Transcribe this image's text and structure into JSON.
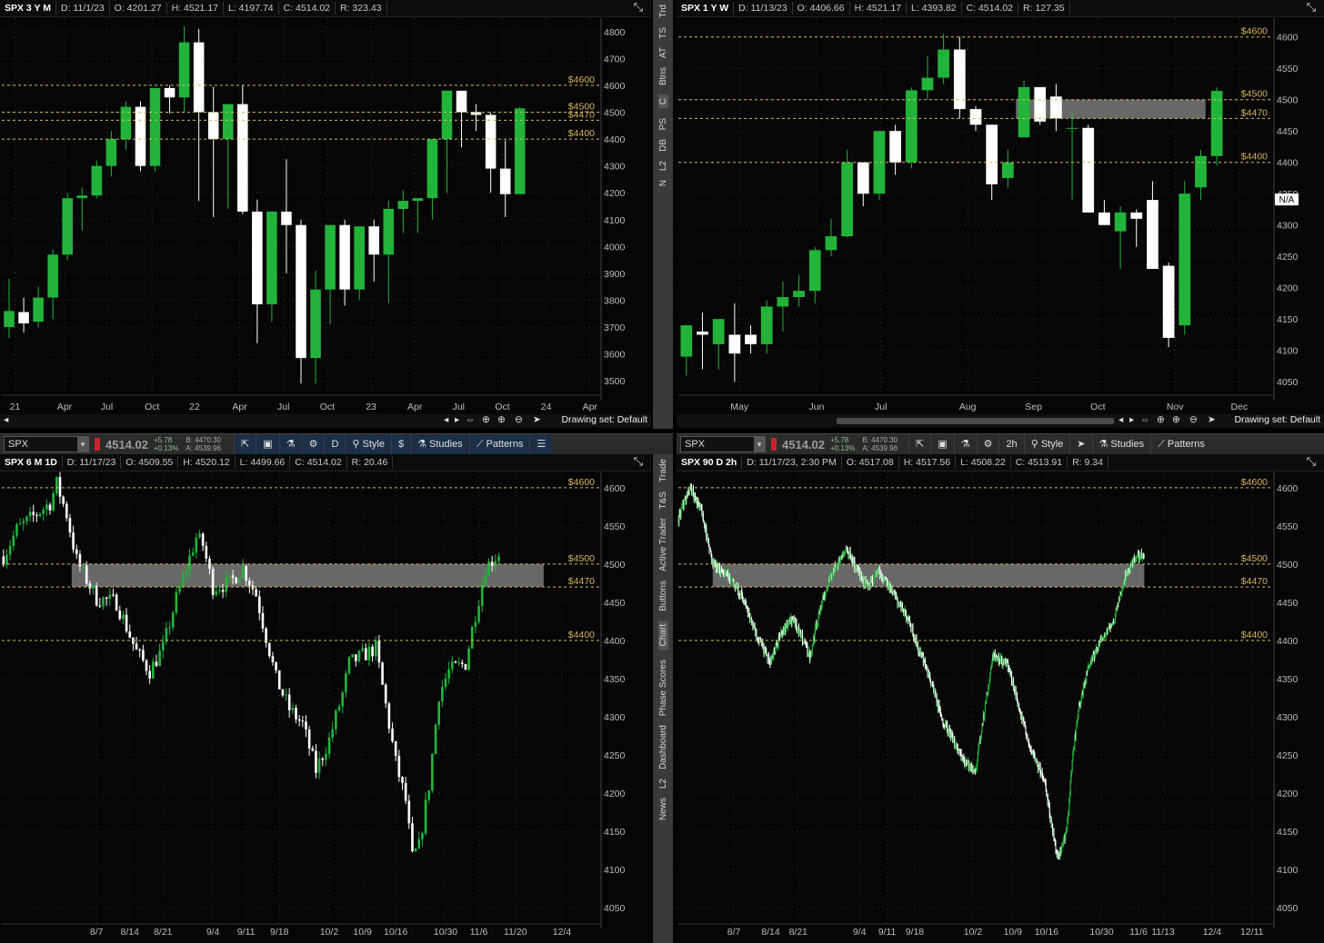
{
  "panels": [
    {
      "id": "tl",
      "header": [
        "SPX 3 Y M",
        "D: 11/1/23",
        "O: 4201.27",
        "H: 4521.17",
        "L: 4197.74",
        "C: 4514.02",
        "R: 323.43"
      ],
      "ylim": [
        3450,
        4850
      ],
      "yticks": [
        3500,
        3600,
        3700,
        3800,
        3900,
        4000,
        4100,
        4200,
        4300,
        4400,
        4500,
        4600,
        4700,
        4800
      ],
      "levels": [
        {
          "price": 4600,
          "label": "$4600"
        },
        {
          "price": 4500,
          "label": "$4500"
        },
        {
          "price": 4470,
          "label": "$4470"
        },
        {
          "price": 4400,
          "label": "$4400"
        }
      ],
      "zone": null,
      "xticks": [
        {
          "i": 0.4,
          "label": "21"
        },
        {
          "i": 3.8,
          "label": "Apr"
        },
        {
          "i": 6.7,
          "label": "Jul"
        },
        {
          "i": 9.8,
          "label": "Oct"
        },
        {
          "i": 12.7,
          "label": "22"
        },
        {
          "i": 15.8,
          "label": "Apr"
        },
        {
          "i": 18.8,
          "label": "Jul"
        },
        {
          "i": 21.8,
          "label": "Oct"
        },
        {
          "i": 24.8,
          "label": "23"
        },
        {
          "i": 27.8,
          "label": "Apr"
        },
        {
          "i": 30.8,
          "label": "Jul"
        },
        {
          "i": 33.8,
          "label": "Oct"
        },
        {
          "i": 36.8,
          "label": "24"
        },
        {
          "i": 39.8,
          "label": "Apr"
        }
      ],
      "slots": 41,
      "candles": [
        [
          3700,
          3880,
          3660,
          3760
        ],
        [
          3756,
          3810,
          3680,
          3714
        ],
        [
          3720,
          3850,
          3700,
          3810
        ],
        [
          3810,
          3990,
          3730,
          3970
        ],
        [
          3970,
          4200,
          3950,
          4180
        ],
        [
          4180,
          4220,
          4060,
          4190
        ],
        [
          4190,
          4320,
          4180,
          4300
        ],
        [
          4300,
          4430,
          4260,
          4400
        ],
        [
          4400,
          4540,
          4360,
          4520
        ],
        [
          4520,
          4540,
          4280,
          4300
        ],
        [
          4300,
          4560,
          4280,
          4590
        ],
        [
          4590,
          4600,
          4495,
          4555
        ],
        [
          4555,
          4820,
          4500,
          4760
        ],
        [
          4760,
          4810,
          4170,
          4500
        ],
        [
          4500,
          4595,
          4110,
          4400
        ],
        [
          4400,
          4510,
          4140,
          4530
        ],
        [
          4530,
          4600,
          4120,
          4130
        ],
        [
          4130,
          4175,
          3640,
          3785
        ],
        [
          3785,
          4130,
          3720,
          4130
        ],
        [
          4130,
          4325,
          3900,
          4080
        ],
        [
          4080,
          4100,
          3490,
          3585
        ],
        [
          3585,
          3910,
          3490,
          3840
        ],
        [
          3840,
          4080,
          3710,
          4080
        ],
        [
          4080,
          4100,
          3780,
          3840
        ],
        [
          3840,
          4040,
          3800,
          4075
        ],
        [
          4075,
          4100,
          3870,
          3970
        ],
        [
          3970,
          4170,
          3790,
          4140
        ],
        [
          4140,
          4210,
          4050,
          4170
        ],
        [
          4170,
          4180,
          4050,
          4180
        ],
        [
          4180,
          4400,
          4100,
          4400
        ],
        [
          4400,
          4540,
          4200,
          4580
        ],
        [
          4580,
          4570,
          4370,
          4500
        ],
        [
          4500,
          4530,
          4430,
          4490
        ],
        [
          4490,
          4500,
          4200,
          4290
        ],
        [
          4290,
          4395,
          4110,
          4195
        ],
        [
          4195,
          4520,
          4195,
          4514
        ]
      ]
    },
    {
      "id": "tr",
      "header": [
        "SPX 1 Y W",
        "D: 11/13/23",
        "O: 4406.66",
        "H: 4521.17",
        "L: 4393.82",
        "C: 4514.02",
        "R: 127.35"
      ],
      "ylim": [
        4030,
        4630
      ],
      "yticks": [
        4050,
        4100,
        4150,
        4200,
        4250,
        4300,
        4350,
        4400,
        4450,
        4500,
        4550,
        4600
      ],
      "levels": [
        {
          "price": 4600,
          "label": "$4600"
        },
        {
          "price": 4500,
          "label": "$4500"
        },
        {
          "price": 4470,
          "label": "$4470"
        },
        {
          "price": 4400,
          "label": "$4400"
        }
      ],
      "zone": {
        "from": 4470,
        "to": 4500,
        "s": 21,
        "e": 32.8
      },
      "xticks": [
        {
          "i": 3.3,
          "label": "May"
        },
        {
          "i": 8.1,
          "label": "Jun"
        },
        {
          "i": 12.1,
          "label": "Jul"
        },
        {
          "i": 17.5,
          "label": "Aug"
        },
        {
          "i": 21.6,
          "label": "Sep"
        },
        {
          "i": 25.6,
          "label": "Oct"
        },
        {
          "i": 30.4,
          "label": "Nov"
        },
        {
          "i": 34.4,
          "label": "Dec"
        }
      ],
      "slots": 37,
      "markers": [
        {
          "i": 36.7,
          "label": "N/A",
          "price": 4340
        }
      ],
      "candles": [
        [
          4090,
          4140,
          4060,
          4140
        ],
        [
          4130,
          4160,
          4070,
          4125
        ],
        [
          4110,
          4150,
          4070,
          4150
        ],
        [
          4125,
          4175,
          4050,
          4095
        ],
        [
          4125,
          4140,
          4095,
          4110
        ],
        [
          4110,
          4180,
          4095,
          4170
        ],
        [
          4170,
          4210,
          4130,
          4185
        ],
        [
          4185,
          4220,
          4170,
          4195
        ],
        [
          4195,
          4265,
          4175,
          4260
        ],
        [
          4260,
          4310,
          4250,
          4282
        ],
        [
          4282,
          4420,
          4280,
          4400
        ],
        [
          4400,
          4400,
          4330,
          4350
        ],
        [
          4350,
          4440,
          4340,
          4450
        ],
        [
          4450,
          4460,
          4380,
          4400
        ],
        [
          4400,
          4520,
          4390,
          4515
        ],
        [
          4515,
          4570,
          4500,
          4535
        ],
        [
          4535,
          4605,
          4525,
          4580
        ],
        [
          4580,
          4600,
          4470,
          4485
        ],
        [
          4485,
          4490,
          4450,
          4460
        ],
        [
          4460,
          4460,
          4340,
          4365
        ],
        [
          4375,
          4420,
          4360,
          4400
        ],
        [
          4440,
          4530,
          4440,
          4520
        ],
        [
          4520,
          4520,
          4460,
          4465
        ],
        [
          4505,
          4525,
          4450,
          4470
        ],
        [
          4455,
          4480,
          4340,
          4455
        ],
        [
          4455,
          4460,
          4320,
          4320
        ],
        [
          4320,
          4340,
          4300,
          4300
        ],
        [
          4290,
          4330,
          4230,
          4320
        ],
        [
          4320,
          4325,
          4265,
          4310
        ],
        [
          4340,
          4370,
          4230,
          4230
        ],
        [
          4235,
          4240,
          4105,
          4120
        ],
        [
          4140,
          4370,
          4125,
          4350
        ],
        [
          4360,
          4420,
          4340,
          4410
        ],
        [
          4410,
          4520,
          4395,
          4514
        ]
      ]
    },
    {
      "id": "bl",
      "header": [
        "SPX 6 M 1D",
        "D: 11/17/23",
        "O: 4509.55",
        "H: 4520.12",
        "L: 4499.66",
        "C: 4514.02",
        "R: 20.46"
      ],
      "ylim": [
        4030,
        4620
      ],
      "yticks": [
        4050,
        4100,
        4150,
        4200,
        4250,
        4300,
        4350,
        4400,
        4450,
        4500,
        4550,
        4600
      ],
      "levels": [
        {
          "price": 4600,
          "label": "$4600"
        },
        {
          "price": 4500,
          "label": "$4500"
        },
        {
          "price": 4470,
          "label": "$4470"
        },
        {
          "price": 4400,
          "label": "$4400"
        }
      ],
      "zone": {
        "from": 4470,
        "to": 4500,
        "s": 21,
        "e": 163
      },
      "xticks": [
        {
          "i": 28,
          "label": "8/7"
        },
        {
          "i": 38,
          "label": "8/14"
        },
        {
          "i": 48,
          "label": "8/21"
        },
        {
          "i": 63,
          "label": "9/4"
        },
        {
          "i": 73,
          "label": "9/11"
        },
        {
          "i": 83,
          "label": "9/18"
        },
        {
          "i": 98,
          "label": "10/2"
        },
        {
          "i": 108,
          "label": "10/9"
        },
        {
          "i": 118,
          "label": "10/16"
        },
        {
          "i": 133,
          "label": "10/30"
        },
        {
          "i": 143,
          "label": "11/6"
        },
        {
          "i": 154,
          "label": "11/20"
        },
        {
          "i": 168,
          "label": "12/4"
        }
      ],
      "slots": 180,
      "gen": {
        "seed": 7,
        "n": 150,
        "vol": 1.0,
        "anchors": [
          [
            0,
            4510
          ],
          [
            4,
            4545
          ],
          [
            14,
            4580
          ],
          [
            16,
            4605
          ],
          [
            19,
            4565
          ],
          [
            22,
            4505
          ],
          [
            28,
            4455
          ],
          [
            34,
            4450
          ],
          [
            40,
            4385
          ],
          [
            44,
            4360
          ],
          [
            48,
            4390
          ],
          [
            52,
            4455
          ],
          [
            58,
            4535
          ],
          [
            60,
            4525
          ],
          [
            63,
            4470
          ],
          [
            68,
            4475
          ],
          [
            72,
            4495
          ],
          [
            76,
            4460
          ],
          [
            79,
            4405
          ],
          [
            82,
            4350
          ],
          [
            86,
            4310
          ],
          [
            90,
            4290
          ],
          [
            94,
            4230
          ],
          [
            98,
            4270
          ],
          [
            102,
            4330
          ],
          [
            104,
            4370
          ],
          [
            108,
            4380
          ],
          [
            112,
            4390
          ],
          [
            115,
            4315
          ],
          [
            118,
            4240
          ],
          [
            121,
            4190
          ],
          [
            123,
            4115
          ],
          [
            125,
            4130
          ],
          [
            128,
            4210
          ],
          [
            131,
            4330
          ],
          [
            134,
            4360
          ],
          [
            139,
            4370
          ],
          [
            141,
            4415
          ],
          [
            143,
            4455
          ],
          [
            145,
            4495
          ],
          [
            147,
            4505
          ],
          [
            149,
            4514
          ]
        ]
      }
    },
    {
      "id": "br",
      "header": [
        "SPX 90 D 2h",
        "D: 11/17/23, 2:30 PM",
        "O: 4517.08",
        "H: 4517.56",
        "L: 4508.22",
        "C: 4513.91",
        "R: 9.34"
      ],
      "ylim": [
        4030,
        4620
      ],
      "yticks": [
        4050,
        4100,
        4150,
        4200,
        4250,
        4300,
        4350,
        4400,
        4450,
        4500,
        4550,
        4600
      ],
      "levels": [
        {
          "price": 4600,
          "label": "$4600"
        },
        {
          "price": 4500,
          "label": "$4500"
        },
        {
          "price": 4470,
          "label": "$4470"
        },
        {
          "price": 4400,
          "label": "$4400"
        }
      ],
      "zone": {
        "from": 4470,
        "to": 4500,
        "s": 56,
        "e": 760
      },
      "xticks": [
        {
          "i": 90,
          "label": "8/7"
        },
        {
          "i": 150,
          "label": "8/14"
        },
        {
          "i": 195,
          "label": "8/21"
        },
        {
          "i": 295,
          "label": "9/4"
        },
        {
          "i": 340,
          "label": "9/11"
        },
        {
          "i": 385,
          "label": "9/18"
        },
        {
          "i": 480,
          "label": "10/2"
        },
        {
          "i": 545,
          "label": "10/9"
        },
        {
          "i": 600,
          "label": "10/16"
        },
        {
          "i": 690,
          "label": "10/30"
        },
        {
          "i": 750,
          "label": "11/6"
        },
        {
          "i": 790,
          "label": "11/13"
        },
        {
          "i": 870,
          "label": "12/4"
        },
        {
          "i": 935,
          "label": "12/11"
        }
      ],
      "slots": 970,
      "gen": {
        "seed": 13,
        "n": 760,
        "vol": 0.55,
        "anchors": [
          [
            0,
            4560
          ],
          [
            20,
            4600
          ],
          [
            40,
            4570
          ],
          [
            60,
            4500
          ],
          [
            80,
            4490
          ],
          [
            110,
            4460
          ],
          [
            130,
            4420
          ],
          [
            160,
            4370
          ],
          [
            180,
            4410
          ],
          [
            200,
            4430
          ],
          [
            230,
            4380
          ],
          [
            250,
            4450
          ],
          [
            270,
            4490
          ],
          [
            295,
            4520
          ],
          [
            310,
            4495
          ],
          [
            330,
            4470
          ],
          [
            350,
            4490
          ],
          [
            370,
            4470
          ],
          [
            400,
            4430
          ],
          [
            420,
            4390
          ],
          [
            440,
            4350
          ],
          [
            460,
            4300
          ],
          [
            480,
            4270
          ],
          [
            500,
            4240
          ],
          [
            520,
            4230
          ],
          [
            550,
            4380
          ],
          [
            575,
            4370
          ],
          [
            590,
            4330
          ],
          [
            600,
            4300
          ],
          [
            620,
            4250
          ],
          [
            640,
            4220
          ],
          [
            655,
            4150
          ],
          [
            665,
            4115
          ],
          [
            680,
            4150
          ],
          [
            690,
            4250
          ],
          [
            700,
            4310
          ],
          [
            720,
            4370
          ],
          [
            740,
            4400
          ],
          [
            760,
            4420
          ],
          [
            780,
            4480
          ],
          [
            800,
            4510
          ],
          [
            815,
            4514
          ]
        ]
      }
    }
  ],
  "toolbars": [
    {
      "symbol": "SPX",
      "last": "4514.02",
      "change": "+5.78",
      "change_pct": "+0.13%",
      "bid": "B: 4470.30",
      "ask": "A: 4539.96",
      "timeframe": "D",
      "style": "Style",
      "studies": "Studies",
      "patterns": "Patterns"
    },
    {
      "symbol": "SPX",
      "last": "4514.02",
      "change": "+5.78",
      "change_pct": "+0.13%",
      "bid": "B: 4470.30",
      "ask": "A: 4539.96",
      "timeframe": "2h",
      "style": "Style",
      "studies": "Studies",
      "patterns": "Patterns"
    }
  ],
  "drawing_set": "Drawing set: Default",
  "sidebar_top": [
    "Trd",
    "TS",
    "AT",
    "Btns",
    "C",
    "PS",
    "DB",
    "L2",
    "N"
  ],
  "sidebar_bottom": [
    "Trade",
    "T&S",
    "Active Trader",
    "Buttons",
    "Chart",
    "Phase Scores",
    "Dashboard",
    "L2",
    "News"
  ],
  "colors": {
    "up": "#22b43a",
    "down": "#ffffff",
    "level": "#d7b55a",
    "zone": "#7a7a7a",
    "grid": "#1c3a1c",
    "axis": "#bdbdbd"
  }
}
